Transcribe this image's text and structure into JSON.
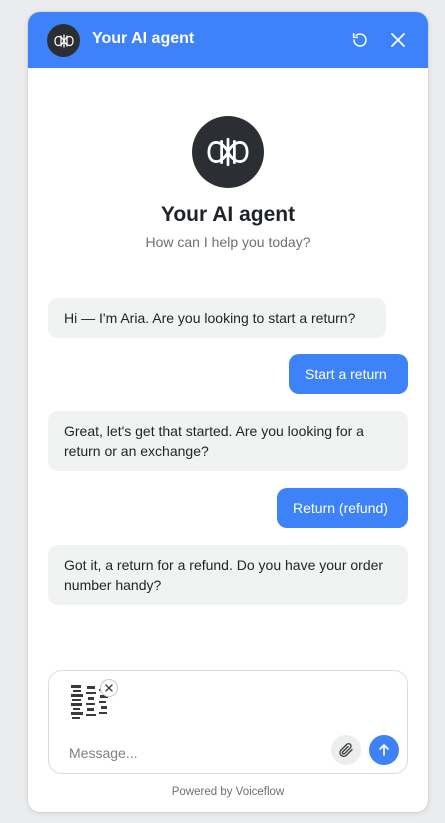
{
  "header": {
    "title": "Your AI agent",
    "avatar_icon": "agent-logo-icon",
    "restart_icon": "restart-icon",
    "close_icon": "close-icon",
    "accent_color": "#3d82f8"
  },
  "hero": {
    "title": "Your AI agent",
    "subtitle": "How can I help you today?"
  },
  "messages": [
    {
      "role": "bot",
      "text": "Hi — I'm Aria. Are you looking to start a return?"
    },
    {
      "role": "user",
      "text": "Start a return"
    },
    {
      "role": "bot",
      "text": "Great, let's get that started. Are you looking for a return or an exchange?"
    },
    {
      "role": "user",
      "text": "Return (refund)"
    },
    {
      "role": "bot",
      "text": "Got it, a return for a refund. Do you have your order number handy?"
    }
  ],
  "composer": {
    "placeholder": "Message...",
    "value": "",
    "attachment_icon": "paperclip-icon",
    "send_icon": "arrow-up-icon",
    "remove_attachment_icon": "close-icon"
  },
  "footer": {
    "powered_by": "Powered by Voiceflow"
  }
}
